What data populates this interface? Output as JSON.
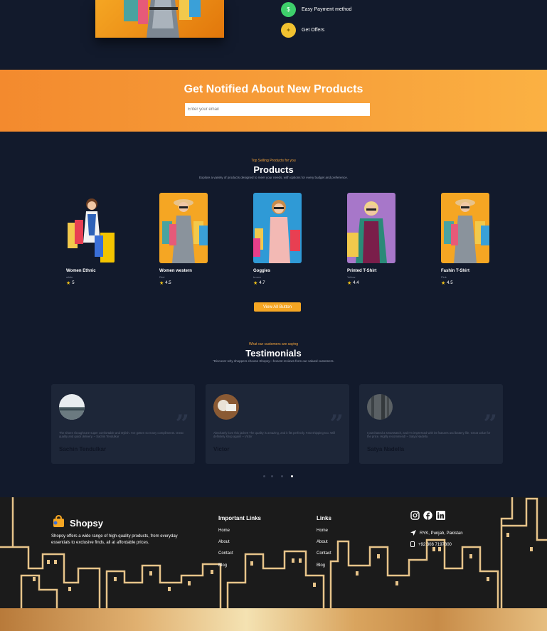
{
  "features": [
    {
      "label": "Easy Payment method",
      "icon": "dollar-icon",
      "color": "#3ecf6b"
    },
    {
      "label": "Get Offers",
      "icon": "gift-icon",
      "color": "#f2c230"
    }
  ],
  "notify": {
    "title": "Get Notified About New Products",
    "placeholder": "Enter your email"
  },
  "products": {
    "eyebrow": "Top Selling Products for you",
    "title": "Products",
    "subtitle": "Explore a variety of products designed to meet your needs, with options for every budget and preference.",
    "items": [
      {
        "name": "Women Ethnic",
        "color": "white",
        "rating": "5"
      },
      {
        "name": "Women western",
        "color": "Red",
        "rating": "4.5"
      },
      {
        "name": "Goggles",
        "color": "brown",
        "rating": "4.7"
      },
      {
        "name": "Printed T-Shirt",
        "color": "Yellow",
        "rating": "4.4"
      },
      {
        "name": "Fashin T-Shirt",
        "color": "Pink",
        "rating": "4.5"
      }
    ],
    "button": "View All Button"
  },
  "testimonials": {
    "eyebrow": "What our customers are saying",
    "title": "Testimonials",
    "subtitle": "\"Discover why shoppers choose Shopsy—honest reviews from our valued customers.",
    "items": [
      {
        "text": "The shoes I bought are super comfortable and stylish. I've gotten so many compliments. Great quality and quick delivery. – Sachin Tendulkar",
        "name": "Sachin Tendulkar"
      },
      {
        "text": "Absolutely love this jacket! The quality is amazing, and it fits perfectly. Fast shipping too. Will definitely shop again! – Victor",
        "name": "Victor"
      },
      {
        "text": "I purchased a smartwatch, and I'm impressed with its features and battery life. Great value for the price. Highly recommend! – Satya Nadella",
        "name": "Satya Nadella"
      }
    ]
  },
  "footer": {
    "brand": "Shopsy",
    "about": "Shopsy offers a wide range of high-quality products, from everyday essentials to exclusive finds, all at affordable prices.",
    "important_title": "Important Links",
    "important_links": [
      "Home",
      "About",
      "Contact",
      "Blog"
    ],
    "links_title": "Links",
    "links": [
      "Home",
      "About",
      "Contact",
      "Blog"
    ],
    "address": "RYK, Punjab, Pakistan",
    "phone": "+92 308 7197800"
  }
}
